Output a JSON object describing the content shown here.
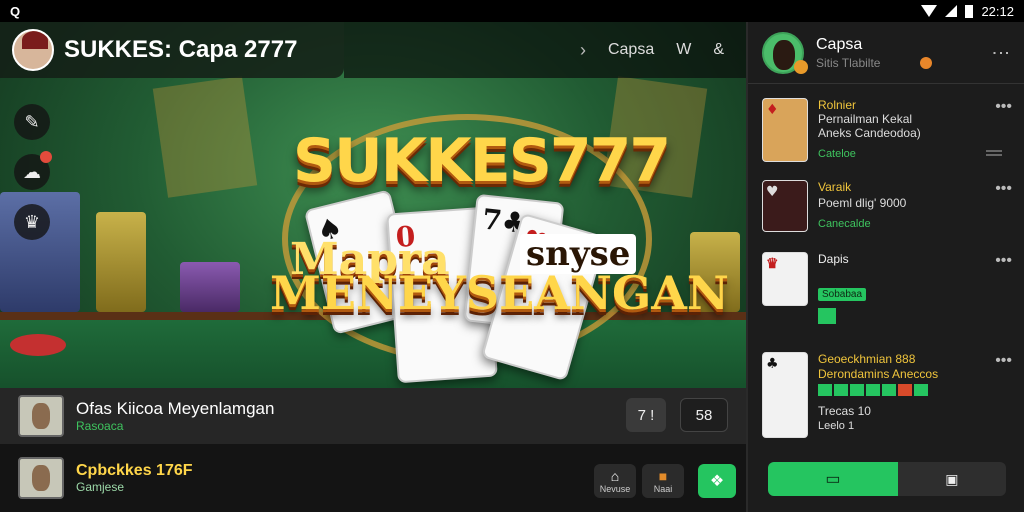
{
  "status_bar": {
    "left_icon": "Q",
    "time": "22:12"
  },
  "header": {
    "title": "SUKKES: Capa 2777"
  },
  "topbar": {
    "category": "Capsa",
    "icon_a": "W",
    "icon_b": "&"
  },
  "artwork": {
    "title": "SUKKES777",
    "line1": "Mapra",
    "line1_tag": "snyse",
    "line2": "MENEYSEANGAN",
    "card1": "♠",
    "card2": "0",
    "card3": "7♣",
    "card4": "♥"
  },
  "side_icons": [
    "pen-icon",
    "chat-icon",
    "crown-icon"
  ],
  "info": {
    "title": "Ofas Kiicoa Meyenlamgan",
    "subtitle": "Rasoaca",
    "btn1": "7 !",
    "btn2": "58"
  },
  "channel": {
    "name": "Cpbckkes 176F",
    "sub": "Gamjese",
    "action1_label": "Nevuse",
    "action2_label": "Naai"
  },
  "panel": {
    "title": "Capsa",
    "subtitle": "Sitis Tlabilte",
    "items": [
      {
        "title": "Rolnier",
        "line1": "Pernailman Kekal",
        "line2": "Aneks Candeodoa)",
        "green": "Cateloe"
      },
      {
        "title": "Varaik",
        "line1": "Poeml dlig' 9000",
        "green": "Canecalde"
      },
      {
        "title": "Dapis",
        "chip": "Sobabaa"
      },
      {
        "title": "Geoeckhmian 888",
        "line1": "Derondamins Aneccos",
        "line2": "Trecas 10",
        "green": "Leelo 1"
      }
    ],
    "footer_a": "▭",
    "footer_b": "▣"
  },
  "colors": {
    "accent_green": "#25c560",
    "gold": "#ffd64a",
    "panel_bg": "#1c1c1c"
  }
}
